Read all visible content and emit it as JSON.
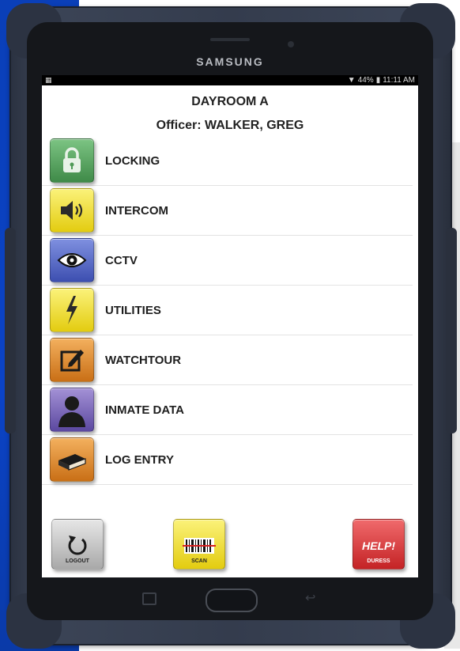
{
  "device": {
    "brand": "SAMSUNG",
    "status_left": "▦",
    "battery": "44%",
    "time": "11:11 AM"
  },
  "header": {
    "title": "DAYROOM A",
    "officer": "Officer: WALKER, GREG"
  },
  "menu": {
    "items": [
      {
        "label": "LOCKING",
        "icon": "lock-icon",
        "color": "#4f9a57"
      },
      {
        "label": "INTERCOM",
        "icon": "speaker-icon",
        "color": "#f2e12c"
      },
      {
        "label": "CCTV",
        "icon": "eye-icon",
        "color": "#4f63c8"
      },
      {
        "label": "UTILITIES",
        "icon": "lightning-icon",
        "color": "#f2e12c"
      },
      {
        "label": "WATCHTOUR",
        "icon": "edit-icon",
        "color": "#e08a2a"
      },
      {
        "label": "INMATE DATA",
        "icon": "person-icon",
        "color": "#7a64b8"
      },
      {
        "label": "LOG ENTRY",
        "icon": "book-icon",
        "color": "#e08a2a"
      }
    ]
  },
  "actions": {
    "logout": {
      "label": "LOGOUT",
      "icon": "logout-icon",
      "color": "#bdbdbd"
    },
    "scan": {
      "label": "SCAN",
      "icon": "barcode-icon",
      "color": "#f2e12c"
    },
    "help": {
      "label": "DURESS",
      "title": "HELP!",
      "icon": "help-icon",
      "color": "#d8393b"
    }
  }
}
